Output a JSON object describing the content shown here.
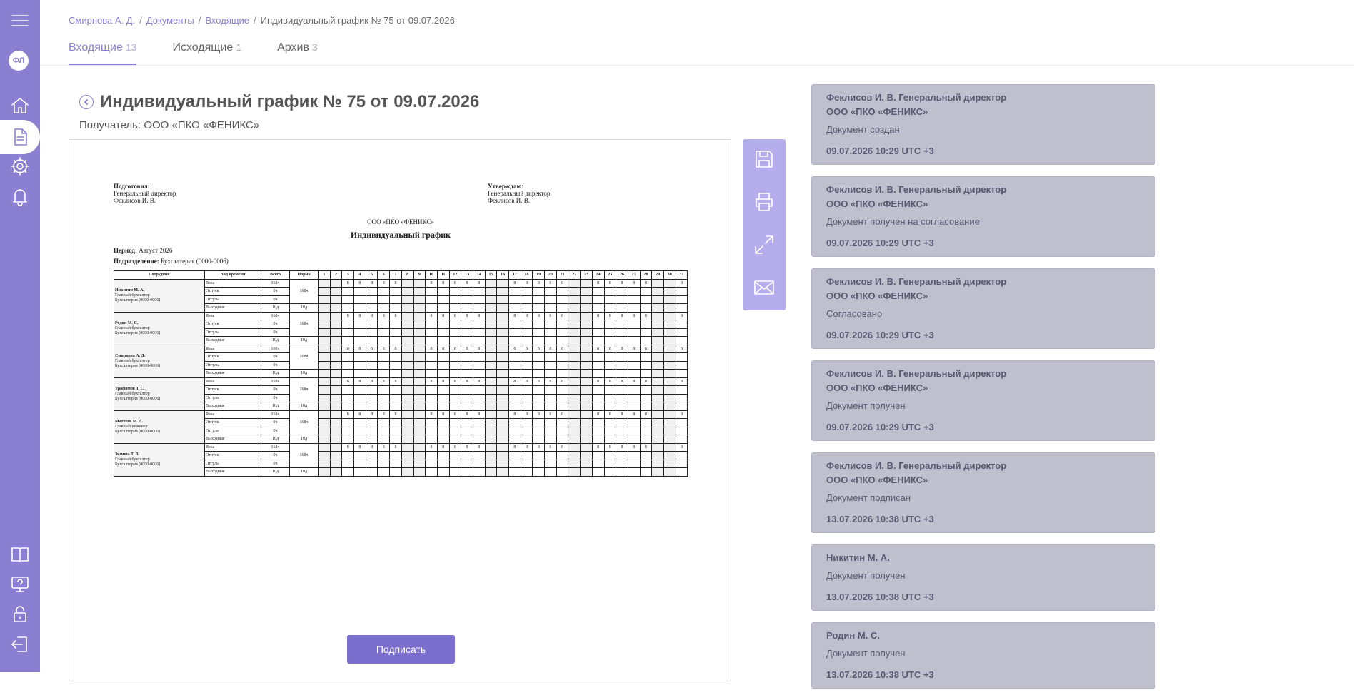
{
  "sidebar": {
    "avatar_initials": "ФЛ",
    "top_icons": [
      "menu-icon",
      "home-icon",
      "documents-icon",
      "settings-icon",
      "notifications-icon"
    ],
    "bottom_icons": [
      "book-icon",
      "help-icon",
      "lock-icon",
      "logout-icon"
    ]
  },
  "breadcrumb": {
    "items": [
      "Смирнова А. Д.",
      "Документы",
      "Входящие"
    ],
    "current": "Индивидуальный график № 75 от 09.07.2026"
  },
  "tabs": [
    {
      "label": "Входящие",
      "count": "13",
      "active": true
    },
    {
      "label": "Исходящие",
      "count": "1",
      "active": false
    },
    {
      "label": "Архив",
      "count": "3",
      "active": false
    }
  ],
  "document": {
    "title": "Индивидуальный график № 75 от 09.07.2026",
    "recipient": "Получатель: ООО «ПКО «ФЕНИКС»",
    "sign_button": "Подписать"
  },
  "paper": {
    "prepared_label": "Подготовил:",
    "prepared_role": "Генеральный директор",
    "prepared_name": "Феклисов И. В.",
    "approve_label": "Утверждаю:",
    "approve_role": "Генеральный директор",
    "approve_name": "Феклисов И. В.",
    "org": "ООО «ПКО «ФЕНИКС»",
    "title": "Индивидуальный график",
    "period_label": "Период:",
    "period": "Август 2026",
    "dept_label": "Подразделение:",
    "dept": "Бухгалтерия (0000-0006)",
    "headers": {
      "employee": "Сотрудник",
      "kind": "Вид времени",
      "total": "Всего",
      "norm": "Норма"
    },
    "days": 31,
    "weekend_days": [
      1,
      2,
      8,
      9,
      15,
      16,
      22,
      23,
      29,
      30
    ],
    "row_kinds": [
      "Явка",
      "Отпуск",
      "Отгулы",
      "Выходные"
    ],
    "row_totals": [
      "168ч",
      "0ч",
      "0ч",
      "10д"
    ],
    "norm_hours": "168ч",
    "norm_days": "10д",
    "hours_mark": "8",
    "employees": [
      {
        "name": "Никитин М. А.",
        "position": "Главный бухгалтер",
        "dept": "Бухгалтерия (0000-0006)"
      },
      {
        "name": "Родин М. С.",
        "position": "Главный бухгалтер",
        "dept": "Бухгалтерия (0000-0006)"
      },
      {
        "name": "Смирнова А. Д.",
        "position": "Главный бухгалтер",
        "dept": "Бухгалтерия (0000-0006)"
      },
      {
        "name": "Трофимов Т. С.",
        "position": "Главный бухгалтер",
        "dept": "Бухгалтерия (0000-0006)"
      },
      {
        "name": "Матвеев М. А.",
        "position": "Главный инженер",
        "dept": "Бухгалтерия (0000-0006)"
      },
      {
        "name": "Зимина Т. В.",
        "position": "Главный бухгалтер",
        "dept": "Бухгалтерия (0000-0006)"
      }
    ]
  },
  "toolbar": [
    "save-icon",
    "print-icon",
    "expand-icon",
    "mail-icon"
  ],
  "events": [
    {
      "who": "Феклисов И. В. Генеральный директор",
      "org": "ООО «ПКО «ФЕНИКС»",
      "what": "Документ создан",
      "when": "09.07.2026 10:29 UTC +3"
    },
    {
      "who": "Феклисов И. В. Генеральный директор",
      "org": "ООО «ПКО «ФЕНИКС»",
      "what": "Документ получен на согласование",
      "when": "09.07.2026 10:29 UTC +3"
    },
    {
      "who": "Феклисов И. В. Генеральный директор",
      "org": "ООО «ПКО «ФЕНИКС»",
      "what": "Согласовано",
      "when": "09.07.2026 10:29 UTC +3"
    },
    {
      "who": "Феклисов И. В. Генеральный директор",
      "org": "ООО «ПКО «ФЕНИКС»",
      "what": "Документ получен",
      "when": "09.07.2026 10:29 UTC +3"
    },
    {
      "who": "Феклисов И. В. Генеральный директор",
      "org": "ООО «ПКО «ФЕНИКС»",
      "what": "Документ подписан",
      "when": "13.07.2026 10:38 UTC +3"
    },
    {
      "who": "Никитин М. А.",
      "org": "",
      "what": "Документ получен",
      "when": "13.07.2026 10:38 UTC +3"
    },
    {
      "who": "Родин М. С.",
      "org": "",
      "what": "Документ получен",
      "when": "13.07.2026 10:38 UTC +3"
    }
  ]
}
